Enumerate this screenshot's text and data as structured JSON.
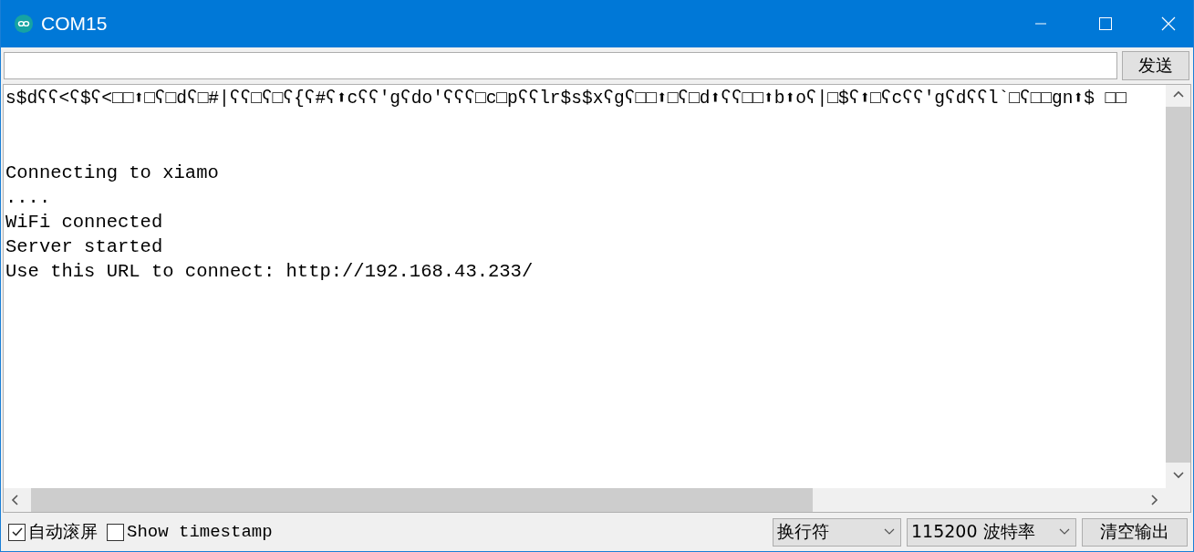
{
  "window": {
    "title": "COM15"
  },
  "send": {
    "button": "发送"
  },
  "output": {
    "garbled_line": "s$dʕʕ<ʕ$ʕ<□□⬆□ʕ□dʕ□#|ʕʕ□ʕ□ʕ{ʕ#ʕ⬆cʕʕ'gʕdo'ʕʕʕ□c□pʕʕlr$s$xʕgʕ□□⬆□ʕ□d⬆ʕʕ□□⬆b⬆oʕ|□$ʕ⬆□ʕcʕʕ'gʕdʕʕl`□ʕ□□gn⬆$ □□",
    "lines": [
      "Connecting to xiamo",
      "....",
      "WiFi connected",
      "Server started",
      "Use this URL to connect: http://192.168.43.233/"
    ]
  },
  "footer": {
    "autoscroll": {
      "label": "自动滚屏",
      "checked": true
    },
    "timestamp": {
      "label": "Show timestamp",
      "checked": false
    },
    "line_ending": "换行符",
    "baud": "115200 波特率",
    "clear": "清空输出"
  }
}
